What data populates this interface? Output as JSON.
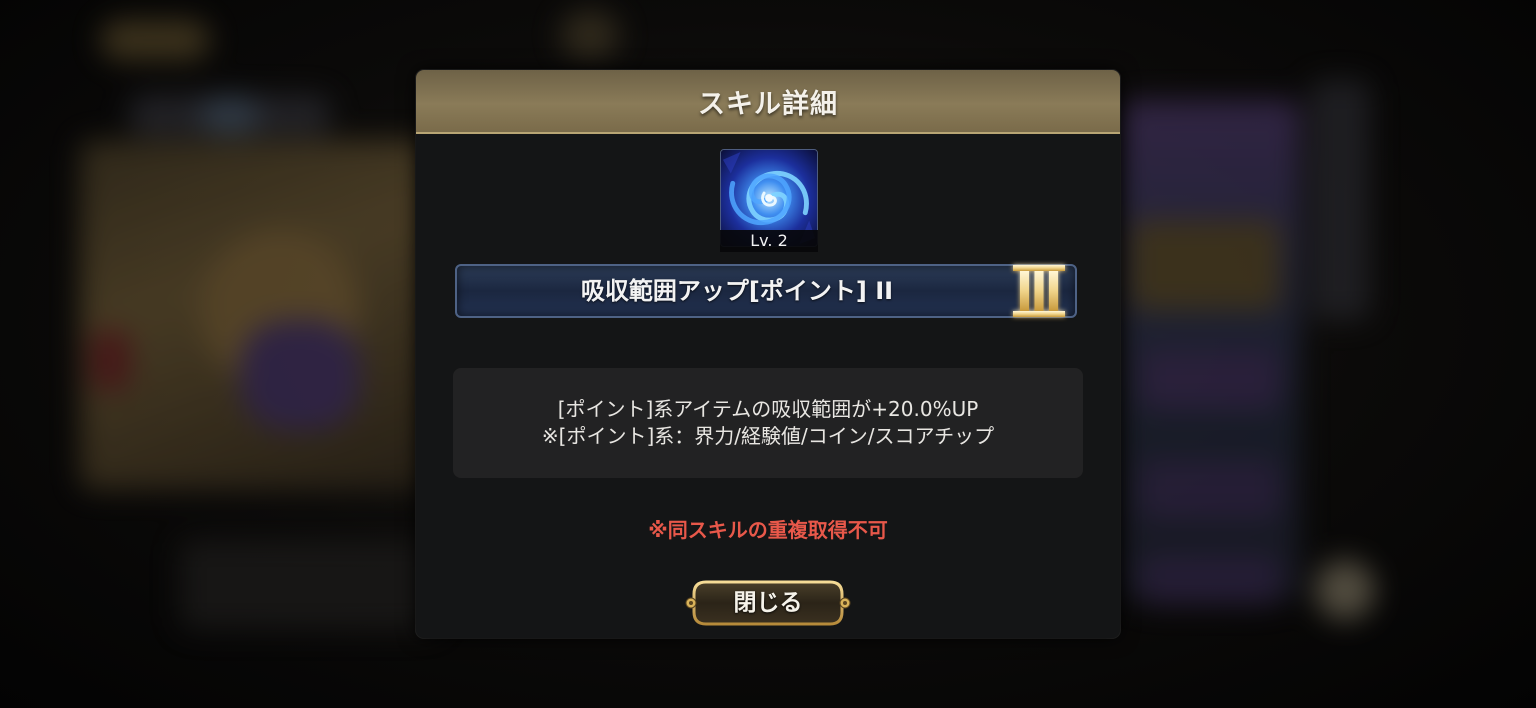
{
  "dialog": {
    "title": "スキル詳細",
    "skill": {
      "icon": "blue-vortex-icon",
      "level": "Lv. 2",
      "name": "吸収範囲アップ[ポイント] II",
      "rank_icon": "roman-numeral-three-icon"
    },
    "description": {
      "line1": "[ポイント]系アイテムの吸収範囲が+20.0%UP",
      "line2": "※[ポイント]系：界力/経験値/コイン/スコアチップ"
    },
    "warning": "※同スキルの重複取得不可",
    "close_button": "閉じる"
  },
  "colors": {
    "header": "#8a7b58",
    "warning": "#e8584a",
    "gold": "#d9b35a",
    "name_bar": "#1b2740"
  }
}
